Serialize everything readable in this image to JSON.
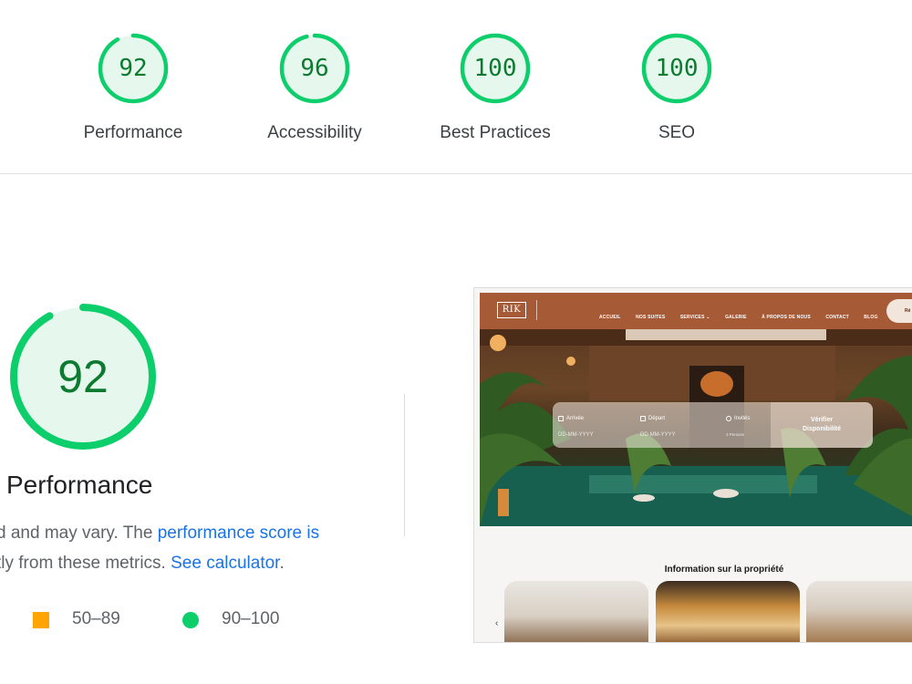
{
  "summary": {
    "gauges": [
      {
        "score": "92",
        "label": "Performance"
      },
      {
        "score": "96",
        "label": "Accessibility"
      },
      {
        "score": "100",
        "label": "Best Practices"
      },
      {
        "score": "100",
        "label": "SEO"
      }
    ]
  },
  "performance": {
    "score": "92",
    "title": "Performance",
    "desc_line1_prefix": "d and may vary. The ",
    "desc_line1_link": "performance score is",
    "desc_line2_prefix": "tly from these metrics. ",
    "desc_line2_link": "See calculator",
    "desc_line2_suffix": ".",
    "legend": [
      {
        "range": "50–89",
        "color": "#ffa400",
        "shape": "square"
      },
      {
        "range": "90–100",
        "color": "#0cce6b",
        "shape": "circle"
      }
    ]
  },
  "colors": {
    "pass_ring": "#0cce6b",
    "pass_fill": "#e6f8ee",
    "pass_text": "#0c7a2f",
    "link": "#1a73e8",
    "site_nav": "#a75a36"
  },
  "screenshot": {
    "logo": "RIK",
    "nav": [
      "ACCUEIL",
      "NOS SUITES",
      "SERVICES ⌄",
      "GALERIE",
      "À PROPOS DE NOUS",
      "CONTACT",
      "BLOG"
    ],
    "nav_button": "Ré",
    "booking": {
      "arrival_label": "Arrivée",
      "arrival_value": "DD-MM-YYYY",
      "departure_label": "Départ",
      "departure_value": "DD-MM-YYYY",
      "guests_label": "Invités",
      "guests_value": "2 Persons",
      "submit_line1": "Vérifier",
      "submit_line2": "Disponibilité"
    },
    "section_title": "Information sur la propriété",
    "carousel_arrow": "‹"
  }
}
